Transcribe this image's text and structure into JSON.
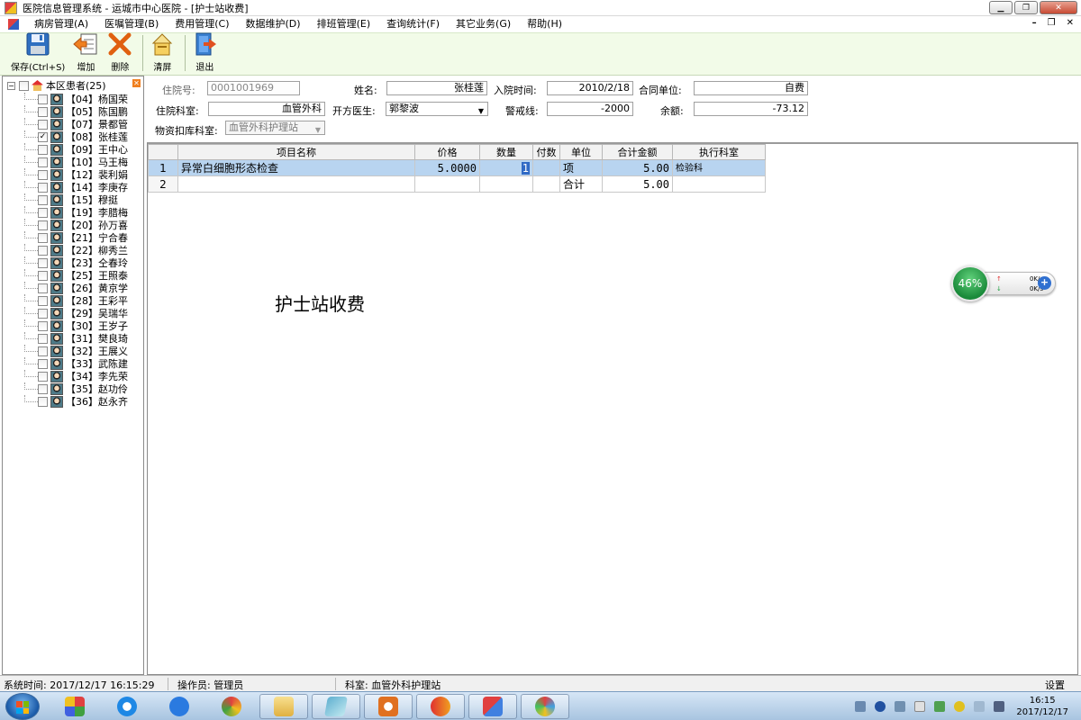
{
  "window": {
    "title": "医院信息管理系统    -   运城市中心医院 - [护士站收费]"
  },
  "menu": [
    "病房管理(A)",
    "医嘱管理(B)",
    "费用管理(C)",
    "数据维护(D)",
    "排班管理(E)",
    "查询统计(F)",
    "其它业务(G)",
    "帮助(H)"
  ],
  "toolbar": {
    "save": "保存(Ctrl+S)",
    "add": "增加",
    "delete": "删除",
    "clear": "清屏",
    "exit": "退出"
  },
  "tree": {
    "root": "本区患者(25)",
    "patients": [
      {
        "label": "【04】杨国荣",
        "checked": false
      },
      {
        "label": "【05】陈国鹏",
        "checked": false
      },
      {
        "label": "【07】景都管",
        "checked": false
      },
      {
        "label": "【08】张桂莲",
        "checked": true
      },
      {
        "label": "【09】王中心",
        "checked": false
      },
      {
        "label": "【10】马王梅",
        "checked": false
      },
      {
        "label": "【12】裴利娟",
        "checked": false
      },
      {
        "label": "【14】李庚存",
        "checked": false
      },
      {
        "label": "【15】穆挺",
        "checked": false
      },
      {
        "label": "【19】李腊梅",
        "checked": false
      },
      {
        "label": "【20】孙万喜",
        "checked": false
      },
      {
        "label": "【21】宁合春",
        "checked": false
      },
      {
        "label": "【22】柳秀兰",
        "checked": false
      },
      {
        "label": "【23】仝春玲",
        "checked": false
      },
      {
        "label": "【25】王照泰",
        "checked": false
      },
      {
        "label": "【26】黄京学",
        "checked": false
      },
      {
        "label": "【28】王彩平",
        "checked": false
      },
      {
        "label": "【29】吴瑞华",
        "checked": false
      },
      {
        "label": "【30】王岁子",
        "checked": false
      },
      {
        "label": "【31】樊良琦",
        "checked": false
      },
      {
        "label": "【32】王展义",
        "checked": false
      },
      {
        "label": "【33】武陈建",
        "checked": false
      },
      {
        "label": "【34】李先荣",
        "checked": false
      },
      {
        "label": "【35】赵功伶",
        "checked": false
      },
      {
        "label": "【36】赵永齐",
        "checked": false
      }
    ]
  },
  "form": {
    "admission_no_label": "住院号:",
    "admission_no": "0001001969",
    "name_label": "姓名:",
    "name": "张桂莲",
    "admit_time_label": "入院时间:",
    "admit_time": "2010/2/18",
    "contract_label": "合同单位:",
    "contract": "自费",
    "dept_label": "住院科室:",
    "dept": "血管外科",
    "doctor_label": "开方医生:",
    "doctor": "郭黎波",
    "warning_label": "警戒线:",
    "warning": "-2000",
    "balance_label": "余额:",
    "balance": "-73.12",
    "material_dept_label": "物资扣库科室:",
    "material_dept": "血管外科护理站"
  },
  "grid": {
    "headers": [
      "项目名称",
      "价格",
      "数量",
      "付数",
      "单位",
      "合计金额",
      "执行科室"
    ],
    "rows": [
      {
        "rn": "1",
        "name": "异常白细胞形态检查",
        "price": "5.0000",
        "qty": "1",
        "fu": "",
        "unit": "项",
        "total": "5.00",
        "exec": "检验科"
      },
      {
        "rn": "2",
        "name": "",
        "price": "",
        "qty": "",
        "fu": "",
        "unit": "合计",
        "total": "5.00",
        "exec": ""
      }
    ]
  },
  "watermark": "护士站收费",
  "net_widget": {
    "percent": "46%",
    "up": "0K/s",
    "down": "0K/s"
  },
  "status": {
    "time": "系统时间: 2017/12/17 16:15:29",
    "operator": "操作员: 管理员",
    "dept": "科室: 血管外科护理站",
    "settings": "设置"
  },
  "taskbar": {
    "time": "16:15",
    "date": "2017/12/17"
  }
}
